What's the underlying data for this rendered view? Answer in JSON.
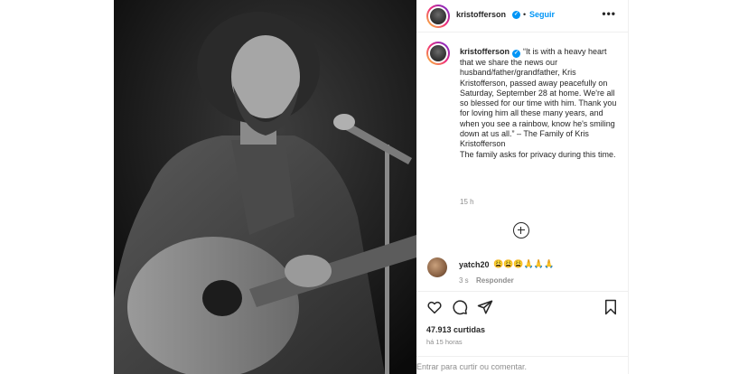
{
  "header": {
    "username": "kristofferson",
    "separator": "•",
    "follow_label": "Seguir",
    "more_label": "•••"
  },
  "caption": {
    "username": "kristofferson",
    "text": "“It is with a heavy heart that we share the news our husband/father/grandfather, Kris Kristofferson, passed away peacefully on Saturday, September 28 at home. We're all so blessed for our time with him. Thank you for loving him all these many years, and when you see a rainbow, know he's smiling down at us all.” – The Family of Kris Kristofferson\nThe family asks for privacy during this time.",
    "time": "15 h"
  },
  "comment": {
    "username": "yatch20",
    "text": "😩😩😩🙏🙏🙏",
    "time": "3 s",
    "reply_label": "Responder"
  },
  "post": {
    "likes": "47.913 curtidas",
    "date": "há 15 horas",
    "comment_placeholder": "Entrar para curtir ou comentar."
  },
  "icons": {
    "like": "heart-icon",
    "comment": "comment-icon",
    "share": "share-icon",
    "save": "bookmark-icon",
    "verified": "verified-badge-icon",
    "load_more": "plus-circle-icon"
  },
  "colors": {
    "accent": "#0095f6",
    "text": "#262626",
    "secondary": "#8e8e8e"
  }
}
